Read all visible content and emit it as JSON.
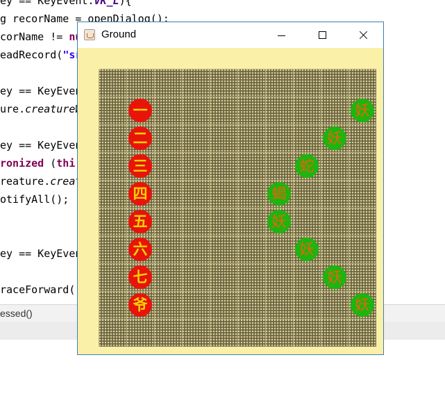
{
  "editor": {
    "lines": [
      {
        "pre": "ey == KeyEvent.",
        "kwit": "VK_L",
        "post": "){"
      },
      {
        "pre": "g recorName = openDialog();"
      },
      {
        "pre": "corName != ",
        "kw": "nu"
      },
      {
        "pre": "eadRecord(",
        "str": "\"sr"
      },
      {
        "pre": ""
      },
      {
        "pre": "ey == KeyEven"
      },
      {
        "pre": "ure.",
        "it": "creatureW"
      },
      {
        "pre": ""
      },
      {
        "pre": "ey == KeyEven"
      },
      {
        "kw2": "ronized",
        "pre2": " (",
        "kw3": "thi"
      },
      {
        "pre": "reature.",
        "it": "creat"
      },
      {
        "pre": "otifyAll();"
      },
      {
        "pre": ""
      },
      {
        "pre": ""
      },
      {
        "pre": "ey == KeyEven"
      },
      {
        "pre": ""
      },
      {
        "pre": "raceForward()"
      }
    ],
    "bottom_tab": "essed()"
  },
  "window": {
    "title": "Ground",
    "icon": "java-cup-icon",
    "controls": {
      "minimize": "minimize-icon",
      "maximize": "maximize-icon",
      "close": "close-icon"
    }
  },
  "board": {
    "cols": 10,
    "rows": 10,
    "heroes": [
      {
        "label": "一",
        "col": 1,
        "row": 1
      },
      {
        "label": "二",
        "col": 1,
        "row": 2
      },
      {
        "label": "三",
        "col": 1,
        "row": 3
      },
      {
        "label": "四",
        "col": 1,
        "row": 4
      },
      {
        "label": "五",
        "col": 1,
        "row": 5
      },
      {
        "label": "六",
        "col": 1,
        "row": 6
      },
      {
        "label": "七",
        "col": 1,
        "row": 7
      },
      {
        "label": "爷",
        "col": 1,
        "row": 8
      }
    ],
    "demons": [
      {
        "label": "妖",
        "col": 9,
        "row": 1
      },
      {
        "label": "妖",
        "col": 8,
        "row": 2
      },
      {
        "label": "蛇",
        "col": 7,
        "row": 3
      },
      {
        "label": "蝎",
        "col": 6,
        "row": 4
      },
      {
        "label": "妖",
        "col": 6,
        "row": 5
      },
      {
        "label": "妖",
        "col": 7,
        "row": 6
      },
      {
        "label": "妖",
        "col": 8,
        "row": 7
      },
      {
        "label": "妖",
        "col": 9,
        "row": 8
      }
    ]
  }
}
